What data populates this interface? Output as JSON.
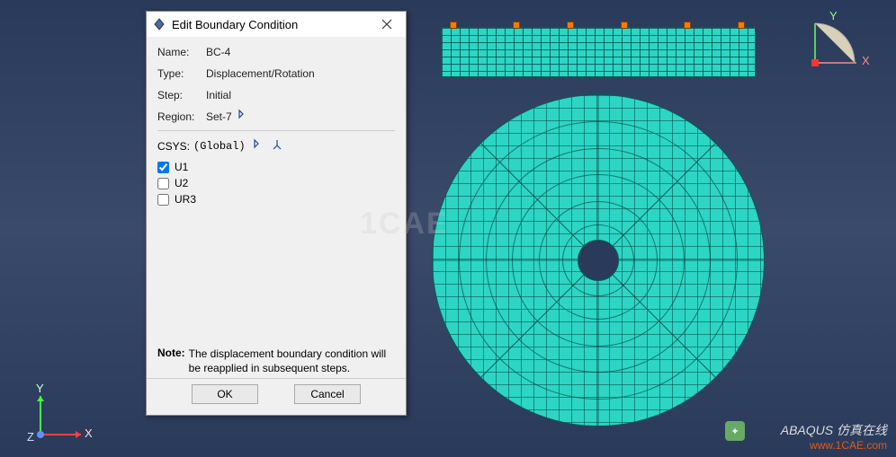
{
  "dialog": {
    "title": "Edit Boundary Condition",
    "name_label": "Name:",
    "name_value": "BC-4",
    "type_label": "Type:",
    "type_value": "Displacement/Rotation",
    "step_label": "Step:",
    "step_value": "Initial",
    "region_label": "Region:",
    "region_value": "Set-7",
    "csys_label": "CSYS:",
    "csys_value": "(Global)",
    "checks": {
      "u1": "U1",
      "u2": "U2",
      "ur3": "UR3"
    },
    "note_label": "Note:",
    "note_text": "The displacement boundary condition will be reapplied in subsequent steps.",
    "ok": "OK",
    "cancel": "Cancel"
  },
  "triad": {
    "x": "X",
    "y": "Y",
    "z": "Z"
  },
  "viewcube": {
    "x": "X",
    "y": "Y"
  },
  "watermark": {
    "center": "1CAE",
    "brand": "ABAQUS 仿真在线",
    "url": "www.1CAE.com"
  }
}
